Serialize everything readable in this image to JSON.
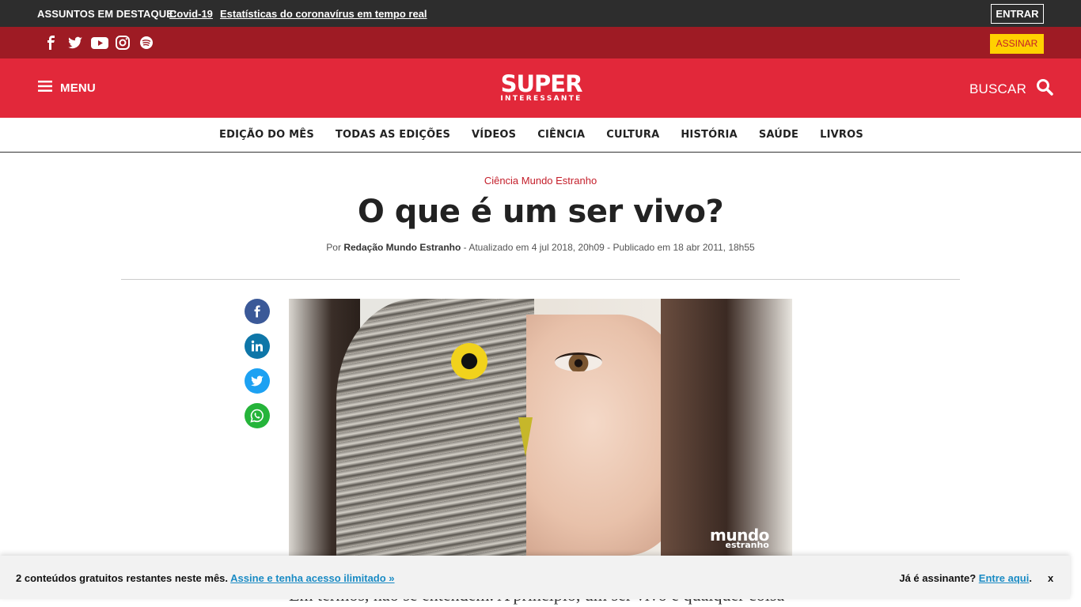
{
  "topbar": {
    "label": "ASSUNTOS EM DESTAQUE:",
    "links": [
      "Covid-19",
      "Estatísticas do coronavírus em tempo real"
    ],
    "login": "ENTRAR"
  },
  "socialbar": {
    "icons": [
      "facebook-icon",
      "twitter-icon",
      "youtube-icon",
      "instagram-icon",
      "spotify-icon"
    ],
    "subscribe": "ASSINAR"
  },
  "header": {
    "menu": "MENU",
    "logo_top": "SUPER",
    "logo_bottom": "INTERESSANTE",
    "search": "BUSCAR"
  },
  "nav": {
    "items": [
      "EDIÇÃO DO MÊS",
      "TODAS AS EDIÇÕES",
      "VÍDEOS",
      "CIÊNCIA",
      "CULTURA",
      "HISTÓRIA",
      "SAÚDE",
      "LIVROS"
    ]
  },
  "article": {
    "category": "Ciência Mundo Estranho",
    "title": "O que é um ser vivo?",
    "byline_prefix": "Por ",
    "author": "Redação Mundo Estranho",
    "byline_rest": " - Atualizado em 4 jul 2018, 20h09 - Publicado em 18 abr 2011, 18h55",
    "image_mark_top": "mundo",
    "image_mark_bottom": "estranho",
    "body_peek": "Em termos, não se entendem. A princípio, um ser vivo é qualquer coisa"
  },
  "share": [
    "facebook",
    "linkedin",
    "twitter",
    "whatsapp"
  ],
  "paywall": {
    "message": "2 conteúdos gratuitos restantes neste mês.",
    "cta": "Assine e tenha acesso ilimitado »",
    "already": "Já é assinante?",
    "login_link": "Entre aqui",
    "close": "x"
  },
  "colors": {
    "brand_red": "#e2283a",
    "dark_red": "#9e1b24",
    "yellow": "#ffd100",
    "link_blue": "#1a8bc4"
  }
}
